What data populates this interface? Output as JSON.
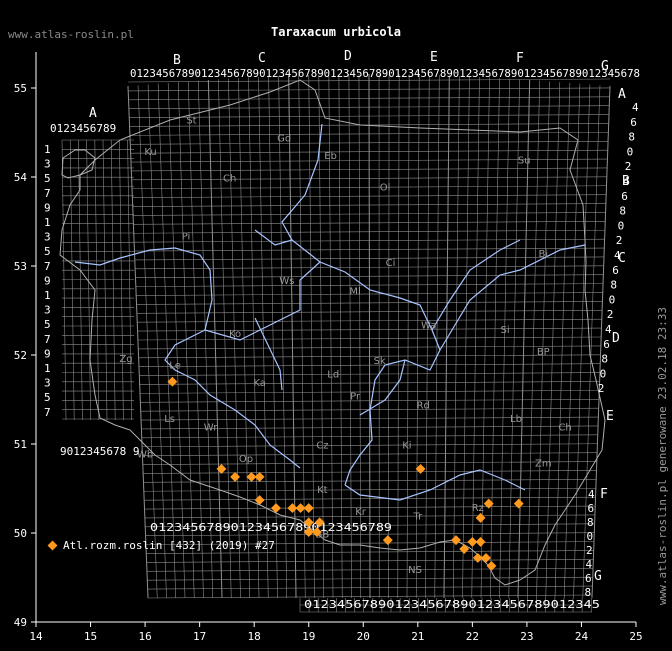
{
  "title": "Taraxacum urbicola",
  "site_label": "www.atlas-roslin.pl",
  "generated_label": "www.atlas-roslin.pl generowane 23.02.18 23:33",
  "legend": {
    "label": "Atl.rozm.roslin [432] (2019) #27",
    "marker_color": "#ff9a1f"
  },
  "colors": {
    "background": "#000000",
    "grid": "#8c8c8c",
    "border": "#b0b0b0",
    "rivers": "#a8c4ff",
    "points": "#ff9a1f"
  },
  "axes": {
    "x_ticks": [
      "14",
      "15",
      "16",
      "17",
      "18",
      "19",
      "20",
      "21",
      "22",
      "23",
      "24",
      "25"
    ],
    "y_ticks": [
      "49",
      "50",
      "51",
      "52",
      "53",
      "54",
      "55"
    ],
    "x_range": [
      14,
      25
    ],
    "y_range": [
      49,
      55.3
    ]
  },
  "grid_labels": {
    "top_letters": [
      "B",
      "C",
      "D",
      "E",
      "F",
      "G"
    ],
    "top_digits": "0123456789012345678901234567890123456789012345678901234567890123456789012345678",
    "left_letter": "A",
    "left_digits": "0123456789",
    "bottom_digits": "012345678901234567890123456789",
    "bottom2_digits": "012345678901234567890123456789012345",
    "lower_left_digits": "9012345678 9",
    "right_letters": [
      "A",
      "B",
      "C",
      "D",
      "E",
      "F",
      "G"
    ],
    "right_digits_top": [
      "4",
      "6",
      "8",
      "0",
      "2",
      "4",
      "6",
      "8",
      "0",
      "2",
      "4",
      "6",
      "8",
      "0",
      "2",
      "4",
      "6",
      "8",
      "0",
      "2"
    ],
    "right_digits_bottom": [
      "4",
      "6",
      "8",
      "0",
      "2",
      "4",
      "6",
      "8"
    ],
    "left_side_digits": [
      "1",
      "3",
      "5",
      "7",
      "9",
      "1",
      "3",
      "5",
      "7",
      "9",
      "1",
      "3",
      "5",
      "7",
      "9",
      "1",
      "3",
      "5",
      "7"
    ]
  },
  "regions": [
    {
      "label": "St",
      "lon": 16.85,
      "lat": 54.6
    },
    {
      "label": "Gd",
      "lon": 18.55,
      "lat": 54.4
    },
    {
      "label": "Eb",
      "lon": 19.4,
      "lat": 54.2
    },
    {
      "label": "Ku",
      "lon": 16.1,
      "lat": 54.25
    },
    {
      "label": "Su",
      "lon": 22.95,
      "lat": 54.15
    },
    {
      "label": "Ch",
      "lon": 17.55,
      "lat": 53.95
    },
    {
      "label": "Ol",
      "lon": 20.4,
      "lat": 53.85
    },
    {
      "label": "Pi",
      "lon": 16.75,
      "lat": 53.3
    },
    {
      "label": "Ci",
      "lon": 20.5,
      "lat": 53.0
    },
    {
      "label": "Bi",
      "lon": 23.3,
      "lat": 53.1
    },
    {
      "label": "Ws",
      "lon": 18.6,
      "lat": 52.8
    },
    {
      "label": "Ml",
      "lon": 19.85,
      "lat": 52.68
    },
    {
      "label": "Ko",
      "lon": 17.65,
      "lat": 52.2
    },
    {
      "label": "Le",
      "lon": 16.55,
      "lat": 51.85
    },
    {
      "label": "Zg",
      "lon": 15.65,
      "lat": 51.92
    },
    {
      "label": "Ka",
      "lon": 18.1,
      "lat": 51.65
    },
    {
      "label": "Ld",
      "lon": 19.45,
      "lat": 51.75
    },
    {
      "label": "Sk",
      "lon": 20.3,
      "lat": 51.9
    },
    {
      "label": "Wa",
      "lon": 21.2,
      "lat": 52.3
    },
    {
      "label": "Si",
      "lon": 22.6,
      "lat": 52.25
    },
    {
      "label": "BP",
      "lon": 23.3,
      "lat": 52.0
    },
    {
      "label": "Pr",
      "lon": 19.85,
      "lat": 51.5
    },
    {
      "label": "Rd",
      "lon": 21.1,
      "lat": 51.4
    },
    {
      "label": "Lb",
      "lon": 22.8,
      "lat": 51.25
    },
    {
      "label": "Ls",
      "lon": 16.45,
      "lat": 51.25
    },
    {
      "label": "Wr",
      "lon": 17.2,
      "lat": 51.15
    },
    {
      "label": "Ch",
      "lon": 23.7,
      "lat": 51.15
    },
    {
      "label": "Ki",
      "lon": 20.8,
      "lat": 50.95
    },
    {
      "label": "Wb",
      "lon": 16.0,
      "lat": 50.85
    },
    {
      "label": "Op",
      "lon": 17.85,
      "lat": 50.8
    },
    {
      "label": "Cz",
      "lon": 19.25,
      "lat": 50.95
    },
    {
      "label": "Zm",
      "lon": 23.3,
      "lat": 50.75
    },
    {
      "label": "Kt",
      "lon": 19.25,
      "lat": 50.45
    },
    {
      "label": "Kr",
      "lon": 19.95,
      "lat": 50.2
    },
    {
      "label": "Tr",
      "lon": 21.0,
      "lat": 50.15
    },
    {
      "label": "Rz",
      "lon": 22.1,
      "lat": 50.25
    },
    {
      "label": "BB",
      "lon": 19.25,
      "lat": 49.95
    },
    {
      "label": "NS",
      "lon": 20.95,
      "lat": 49.55
    }
  ],
  "points": [
    {
      "lon": 16.5,
      "lat": 51.7
    },
    {
      "lon": 17.4,
      "lat": 50.72
    },
    {
      "lon": 17.65,
      "lat": 50.63
    },
    {
      "lon": 17.95,
      "lat": 50.63
    },
    {
      "lon": 18.1,
      "lat": 50.63
    },
    {
      "lon": 18.1,
      "lat": 50.37
    },
    {
      "lon": 18.4,
      "lat": 50.28
    },
    {
      "lon": 18.7,
      "lat": 50.28
    },
    {
      "lon": 18.85,
      "lat": 50.28
    },
    {
      "lon": 19.0,
      "lat": 50.28
    },
    {
      "lon": 19.0,
      "lat": 50.12
    },
    {
      "lon": 19.2,
      "lat": 50.12
    },
    {
      "lon": 19.0,
      "lat": 50.01
    },
    {
      "lon": 19.15,
      "lat": 50.01
    },
    {
      "lon": 20.45,
      "lat": 49.92
    },
    {
      "lon": 21.05,
      "lat": 50.72
    },
    {
      "lon": 21.7,
      "lat": 49.92
    },
    {
      "lon": 21.85,
      "lat": 49.82
    },
    {
      "lon": 22.0,
      "lat": 49.9
    },
    {
      "lon": 22.15,
      "lat": 49.9
    },
    {
      "lon": 22.15,
      "lat": 50.17
    },
    {
      "lon": 22.3,
      "lat": 50.33
    },
    {
      "lon": 22.85,
      "lat": 50.33
    },
    {
      "lon": 22.1,
      "lat": 49.72
    },
    {
      "lon": 22.25,
      "lat": 49.72
    },
    {
      "lon": 22.35,
      "lat": 49.63
    }
  ]
}
